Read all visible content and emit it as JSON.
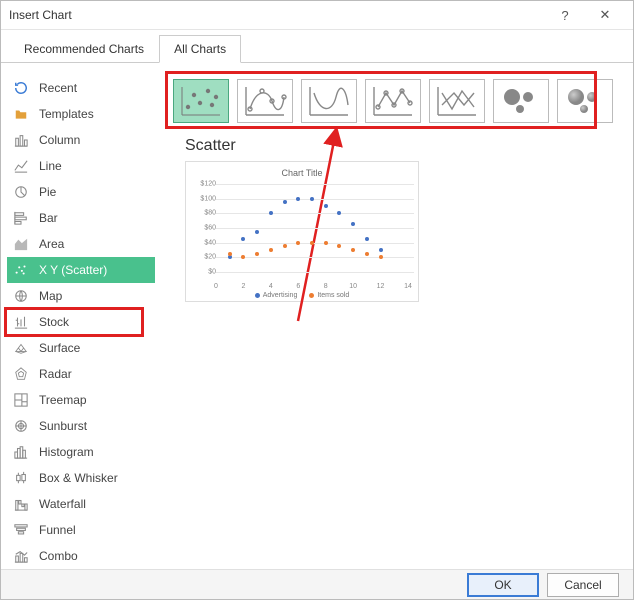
{
  "window": {
    "title": "Insert Chart",
    "help": "?",
    "close": "✕"
  },
  "tabs": {
    "recommended": "Recommended Charts",
    "all": "All Charts"
  },
  "sidebar": {
    "items": [
      {
        "id": "recent",
        "label": "Recent"
      },
      {
        "id": "templates",
        "label": "Templates"
      },
      {
        "id": "column",
        "label": "Column"
      },
      {
        "id": "line",
        "label": "Line"
      },
      {
        "id": "pie",
        "label": "Pie"
      },
      {
        "id": "bar",
        "label": "Bar"
      },
      {
        "id": "area",
        "label": "Area"
      },
      {
        "id": "xy",
        "label": "X Y (Scatter)"
      },
      {
        "id": "map",
        "label": "Map"
      },
      {
        "id": "stock",
        "label": "Stock"
      },
      {
        "id": "surface",
        "label": "Surface"
      },
      {
        "id": "radar",
        "label": "Radar"
      },
      {
        "id": "treemap",
        "label": "Treemap"
      },
      {
        "id": "sunburst",
        "label": "Sunburst"
      },
      {
        "id": "histogram",
        "label": "Histogram"
      },
      {
        "id": "boxwhisker",
        "label": "Box & Whisker"
      },
      {
        "id": "waterfall",
        "label": "Waterfall"
      },
      {
        "id": "funnel",
        "label": "Funnel"
      },
      {
        "id": "combo",
        "label": "Combo"
      }
    ]
  },
  "subtype_selected_heading": "Scatter",
  "preview": {
    "title": "Chart Title"
  },
  "legend": {
    "s1": "Advertising",
    "s2": "Items sold"
  },
  "footer": {
    "ok": "OK",
    "cancel": "Cancel"
  },
  "chart_data": {
    "type": "scatter",
    "title": "Chart Title",
    "xlabel": "",
    "ylabel": "",
    "xticks": [
      0,
      2,
      4,
      6,
      8,
      10,
      12,
      14
    ],
    "ytick_labels": [
      "$0",
      "$20",
      "$40",
      "$60",
      "$80",
      "$100",
      "$120"
    ],
    "ylim": [
      0,
      120
    ],
    "xlim": [
      0,
      14
    ],
    "series": [
      {
        "name": "Advertising",
        "color": "#4472c4",
        "points": [
          {
            "x": 1,
            "y": 20
          },
          {
            "x": 2,
            "y": 45
          },
          {
            "x": 3,
            "y": 55
          },
          {
            "x": 4,
            "y": 80
          },
          {
            "x": 5,
            "y": 95
          },
          {
            "x": 6,
            "y": 100
          },
          {
            "x": 7,
            "y": 100
          },
          {
            "x": 8,
            "y": 90
          },
          {
            "x": 9,
            "y": 80
          },
          {
            "x": 10,
            "y": 65
          },
          {
            "x": 11,
            "y": 45
          },
          {
            "x": 12,
            "y": 30
          }
        ]
      },
      {
        "name": "Items sold",
        "color": "#ed7d31",
        "points": [
          {
            "x": 1,
            "y": 25
          },
          {
            "x": 2,
            "y": 20
          },
          {
            "x": 3,
            "y": 25
          },
          {
            "x": 4,
            "y": 30
          },
          {
            "x": 5,
            "y": 35
          },
          {
            "x": 6,
            "y": 40
          },
          {
            "x": 7,
            "y": 40
          },
          {
            "x": 8,
            "y": 40
          },
          {
            "x": 9,
            "y": 35
          },
          {
            "x": 10,
            "y": 30
          },
          {
            "x": 11,
            "y": 25
          },
          {
            "x": 12,
            "y": 20
          }
        ]
      }
    ]
  }
}
